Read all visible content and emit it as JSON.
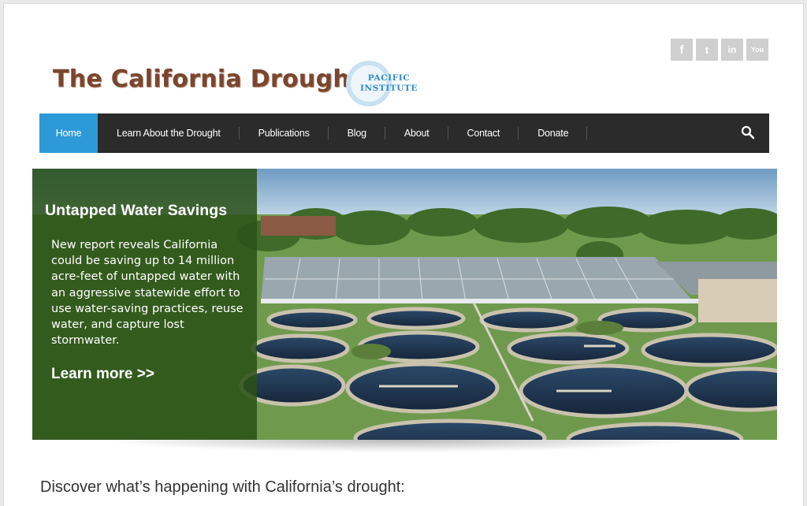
{
  "social": [
    {
      "icon": "facebook-icon",
      "glyph": "f"
    },
    {
      "icon": "twitter-icon",
      "glyph": "t"
    },
    {
      "icon": "linkedin-icon",
      "glyph": "in"
    },
    {
      "icon": "youtube-icon",
      "glyph": "You"
    }
  ],
  "header": {
    "title": "The California Drought",
    "partner_line1": "PACIFIC",
    "partner_line2": "INSTITUTE"
  },
  "nav": {
    "items": [
      "Home",
      "Learn About the Drought",
      "Publications",
      "Blog",
      "About",
      "Contact",
      "Donate"
    ],
    "active": "Home"
  },
  "hero": {
    "title": "Untapped Water Savings",
    "body": "New report reveals California could be saving up to 14 million acre-feet of untapped water with an aggressive statewide effort to use water-saving practices, reuse water, and capture lost stormwater.",
    "link": "Learn more >>"
  },
  "intro": "Discover what’s happening with California’s drought:",
  "colors": {
    "accent": "#2d9ad8",
    "nav_bg": "#2b2b2b",
    "panel_bg": "#2a5016",
    "title": "#7a4630"
  }
}
